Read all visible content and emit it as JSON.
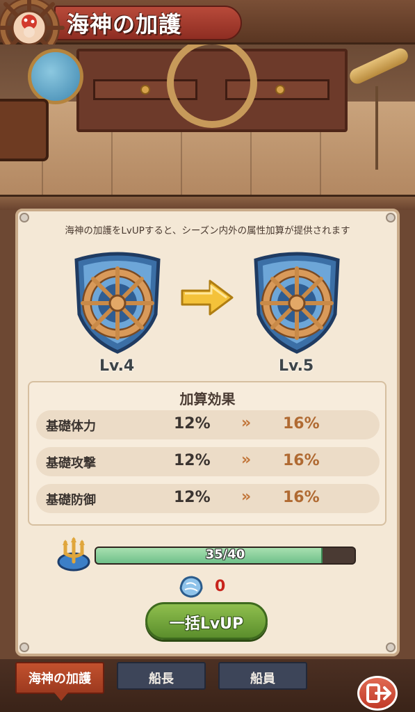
{
  "header": {
    "title": "海神の加護"
  },
  "description": "海神の加護をLvUPすると、シーズン内外の属性加算が提供されます",
  "levels": {
    "current": "Lv.4",
    "next": "Lv.5"
  },
  "effects": {
    "title": "加算効果",
    "rows": [
      {
        "name": "基礎体力",
        "current": "12%",
        "next": "16%"
      },
      {
        "name": "基礎攻撃",
        "current": "12%",
        "next": "16%"
      },
      {
        "name": "基礎防御",
        "current": "12%",
        "next": "16%"
      }
    ],
    "chevron": "»"
  },
  "progress": {
    "text": "35/40",
    "value": 35,
    "max": 40
  },
  "currency": {
    "count": "0"
  },
  "buttons": {
    "bulk_lvup": "一括LvUP"
  },
  "tabs": [
    {
      "label": "海神の加護",
      "active": true
    },
    {
      "label": "船長",
      "active": false
    },
    {
      "label": "船員",
      "active": false
    }
  ],
  "colors": {
    "accent": "#b06a32",
    "button": "#6fa33a",
    "bar": "#8fd3a0",
    "tab_active": "#b0442a",
    "tab_inactive": "#3d4559"
  },
  "icons": {
    "badge": "ship-wheel-icon",
    "emblem": "ship-wheel-shield-icon",
    "arrow": "arrow-right-icon",
    "trident": "trident-icon",
    "shell": "shell-icon",
    "exit": "exit-icon"
  }
}
